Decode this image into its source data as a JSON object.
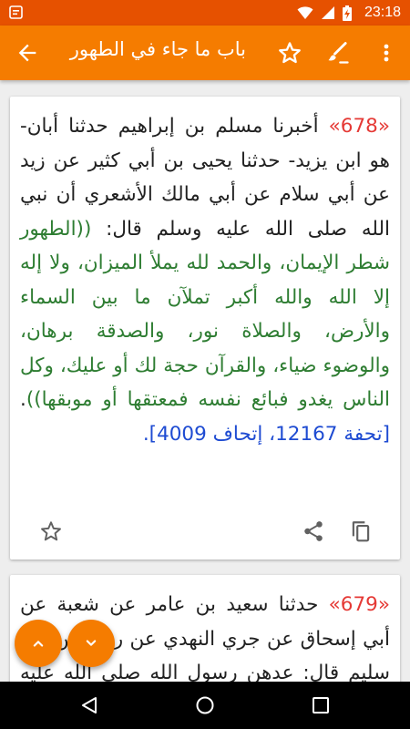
{
  "status": {
    "time": "23:18"
  },
  "toolbar": {
    "title": "باب ما جاء في الطهور"
  },
  "hadiths": [
    {
      "number": "«678»",
      "intro": " أخبرنا مسلم بن إبراهيم حدثنا أبان- هو ابن يزيد- حدثنا يحيى بن أبي كثير عن زيد عن أبي سلام عن أبي مالك الأشعري أن نبي الله صلى الله عليه وسلم قال: ",
      "matn": "((الطهور شطر الإيمان، والحمد لله يملأ الميزان، ولا إله إلا الله والله أكبر تملآن ما بين السماء والأرض، والصلاة نور، والصدقة برهان، والوضوء ضياء، والقرآن حجة لك أو عليك، وكل الناس يغدو فبائع نفسه فمعتقها أو موبقها))",
      "dot": ". ",
      "ref": "[تحفة 12167، إتحاف 4009]."
    },
    {
      "number": "«679»",
      "intro": " حدثنا سعيد بن عامر عن شعبة عن أبي إسحاق عن جري النهدي عن رجل من بني سليم قال: عدهن رسول الله صلى الله عليه وسلم في يدي"
    }
  ],
  "colors": {
    "accent": "#f57c00",
    "status": "#e65100",
    "number": "#e53935",
    "matn": "#2e7d32",
    "ref": "#1e4bd2"
  },
  "icons": [
    "back-arrow-icon",
    "star-outline-icon",
    "brush-icon",
    "more-vert-icon",
    "share-icon",
    "copy-icon",
    "chevron-up-icon",
    "chevron-down-icon"
  ]
}
